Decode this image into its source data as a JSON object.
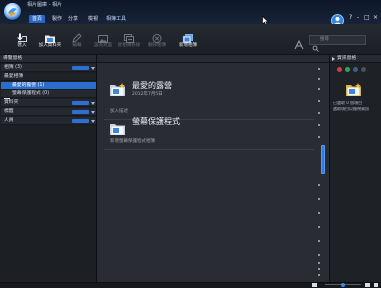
{
  "app": {
    "title": "相片圖庫 - 相片",
    "window_controls": {
      "help": "?",
      "minimize": "-",
      "maximize": "□",
      "close": "×"
    },
    "account_icon": "account-avatar-icon"
  },
  "tabs": [
    {
      "label": "首頁",
      "active": true
    },
    {
      "label": "製作",
      "active": false
    },
    {
      "label": "分享",
      "active": false
    },
    {
      "label": "檢視",
      "active": false
    },
    {
      "label": "相簿工具",
      "active": false
    }
  ],
  "ribbon": {
    "items": [
      {
        "label": "匯入",
        "icon": "import-icon",
        "enabled": true
      },
      {
        "label": "加入資料夾",
        "icon": "add-folder-icon",
        "enabled": true
      },
      {
        "label": "編輯",
        "icon": "edit-icon",
        "enabled": false
      },
      {
        "label": "設為封面",
        "icon": "set-cover-icon",
        "enabled": false
      },
      {
        "label": "從相簿移除",
        "icon": "remove-from-album-icon",
        "enabled": false
      },
      {
        "label": "刪除相簿",
        "icon": "delete-album-icon",
        "enabled": false
      },
      {
        "label": "新增相簿",
        "icon": "new-album-icon",
        "enabled": true
      }
    ],
    "sign_in_icon": "sign-in-icon",
    "search": {
      "placeholder": "搜尋",
      "value": "",
      "icon": "search-icon"
    }
  },
  "nav_pane": {
    "header": "導覽窗格",
    "header_icons": [
      "view-options-icon",
      "filter-icon",
      "pane-menu-icon"
    ],
    "items": [
      {
        "label": "相簿 (3)",
        "kind": "section",
        "selected": false
      },
      {
        "label": "最愛相簿",
        "kind": "subsection",
        "selected": false
      },
      {
        "label": "最愛的露營 (1)",
        "kind": "album",
        "selected": true
      },
      {
        "label": "螢幕保護程式 (0)",
        "kind": "album",
        "selected": false
      },
      {
        "label": "資料夾",
        "kind": "section",
        "selected": false
      },
      {
        "label": "標籤",
        "kind": "section",
        "selected": false
      },
      {
        "label": "人員",
        "kind": "section",
        "selected": false
      }
    ]
  },
  "content_toolbar": {
    "icons": [
      "favorite-icon",
      "rotate-left-icon",
      "rotate-right-icon",
      "slideshow-icon",
      "view-mode-icon"
    ]
  },
  "albums": [
    {
      "title": "最愛的露營",
      "date": "2012年7月5日",
      "description": "加入描述",
      "favorite": true
    },
    {
      "title": "螢幕保護程式",
      "description": "新增螢幕保護程式相簿",
      "favorite": false
    }
  ],
  "info_pane": {
    "header": "資訊窗格",
    "tag_colors": [
      "#c94040",
      "#3a9f5a",
      "#3d5f86",
      "#4b5058"
    ],
    "lines": [
      "已選取 0 個項目",
      "選取項目以檢視資訊"
    ]
  },
  "status_bar": {
    "zoom_level": 0.5
  },
  "colors": {
    "accent": "#2766c9",
    "selection": "#2b6dcc",
    "background": "#15171b",
    "panel": "#1e2126",
    "content": "#292c32"
  }
}
